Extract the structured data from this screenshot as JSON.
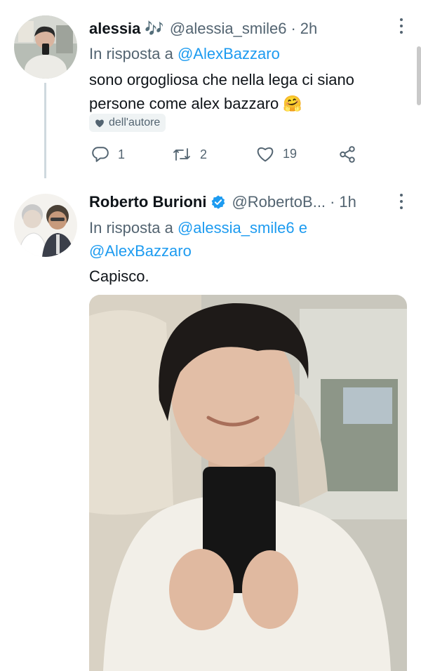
{
  "tweets": [
    {
      "name": "alessia",
      "name_emoji": "🎶",
      "handle": "@alessia_smile6",
      "time": "2h",
      "reply_prefix": "In risposta a",
      "reply_to": "@AlexBazzaro",
      "text": "sono orgogliosa che nella lega ci siano persone come alex bazzaro 🤗",
      "badge": "dell'autore",
      "counts": {
        "replies": "1",
        "retweets": "2",
        "likes": "19"
      },
      "avatar_icon": "selfie-photo"
    },
    {
      "name": "Roberto Burioni",
      "verified_icon": "verified-badge-icon",
      "handle": "@RobertoB...",
      "time": "1h",
      "reply_prefix": "In risposta a",
      "reply_to_1": "@alessia_smile6",
      "reply_and": "e",
      "reply_to_2": "@AlexBazzaro",
      "text": "Capisco.",
      "avatar_icon": "two-men-photo",
      "media_icon": "selfie-photo"
    }
  ],
  "colors": {
    "accent": "#1d9bf0",
    "muted": "#536471",
    "text": "#0f1419",
    "verified": "#1d9bf0"
  }
}
